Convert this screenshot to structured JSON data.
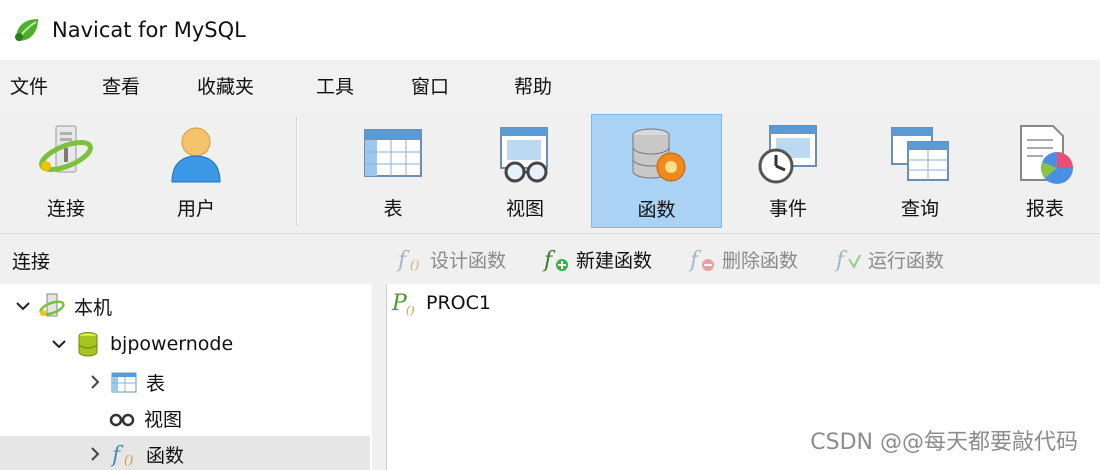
{
  "window": {
    "title": "Navicat for MySQL"
  },
  "menu": {
    "items": [
      "文件",
      "查看",
      "收藏夹",
      "工具",
      "窗口",
      "帮助"
    ]
  },
  "toolbar": {
    "buttons": [
      {
        "label": "连接",
        "icon": "connection-icon"
      },
      {
        "label": "用户",
        "icon": "user-icon"
      },
      {
        "label": "表",
        "icon": "table-icon"
      },
      {
        "label": "视图",
        "icon": "view-icon"
      },
      {
        "label": "函数",
        "icon": "function-icon",
        "active": true
      },
      {
        "label": "事件",
        "icon": "event-icon"
      },
      {
        "label": "查询",
        "icon": "query-icon"
      },
      {
        "label": "报表",
        "icon": "report-icon"
      }
    ]
  },
  "subbar": {
    "connection_label": "连接",
    "actions": [
      {
        "label": "设计函数",
        "icon": "design-function-icon",
        "enabled": false
      },
      {
        "label": "新建函数",
        "icon": "new-function-icon",
        "enabled": true
      },
      {
        "label": "删除函数",
        "icon": "delete-function-icon",
        "enabled": false
      },
      {
        "label": "运行函数",
        "icon": "run-function-icon",
        "enabled": false
      }
    ]
  },
  "tree": {
    "items": [
      {
        "label": "本机",
        "icon": "server-connection-icon",
        "expanded": true
      },
      {
        "label": "bjpowernode",
        "icon": "database-icon",
        "expanded": true
      },
      {
        "label": "表",
        "icon": "table-icon",
        "expanded": false
      },
      {
        "label": "视图",
        "icon": "view-icon"
      },
      {
        "label": "函数",
        "icon": "function-icon",
        "expanded": false,
        "selected": true
      }
    ]
  },
  "objects": {
    "items": [
      {
        "label": "PROC1",
        "icon": "procedure-icon"
      }
    ]
  },
  "watermark": "CSDN @@每天都要敲代码",
  "colors": {
    "active_toolbar": "#a9d2f5",
    "menubar_bg": "#f1f1f1",
    "toolbar_bg": "#f0f0f0",
    "selected_row": "#e6e6e6"
  }
}
